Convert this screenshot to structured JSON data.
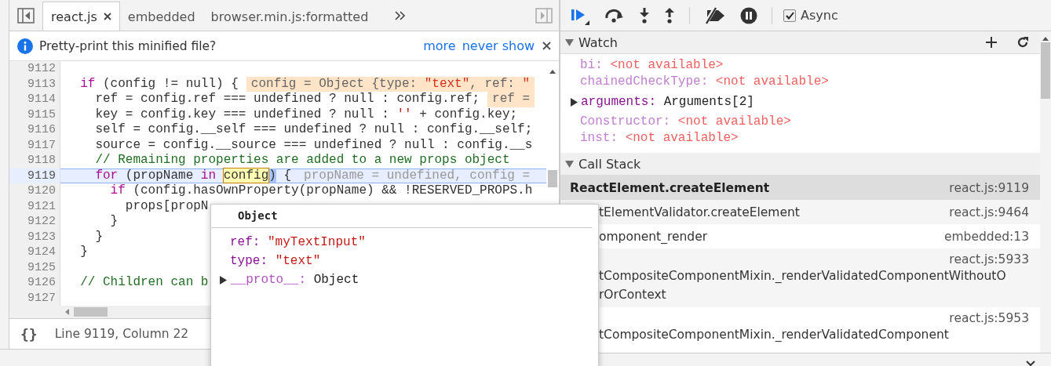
{
  "editor": {
    "tabs": [
      {
        "label": "react.js",
        "selected": true,
        "closable": true
      },
      {
        "label": "embedded",
        "selected": false,
        "closable": false
      },
      {
        "label": "browser.min.js:formatted",
        "selected": false,
        "closable": false
      }
    ],
    "infobar": {
      "message": "Pretty-print this minified file?",
      "links": [
        "more",
        "never show"
      ]
    },
    "lines": [
      {
        "number": "9112",
        "current": false
      },
      {
        "number": "9113",
        "current": false,
        "tokens": [
          {
            "kind": "kw",
            "t": "  if"
          },
          {
            "kind": "plain",
            "t": " (config != null) {"
          }
        ],
        "annotation": {
          "kind": "changed",
          "tokens": [
            {
              "kind": "plain",
              "t": "config = Object {type: "
            },
            {
              "kind": "str",
              "t": "\"text\""
            },
            {
              "kind": "plain",
              "t": ", ref: "
            },
            {
              "kind": "str",
              "t": "\""
            }
          ]
        }
      },
      {
        "number": "9114",
        "current": false,
        "tokens": [
          {
            "kind": "plain",
            "t": "    ref = config.ref === undefined ? null : config.ref;"
          }
        ],
        "annotation": {
          "kind": "changed",
          "tokens": [
            {
              "kind": "plain",
              "t": "ref ="
            }
          ]
        }
      },
      {
        "number": "9115",
        "current": false,
        "tokens": [
          {
            "kind": "plain",
            "t": "    key = config.key === undefined ? null : "
          },
          {
            "kind": "str",
            "t": "''"
          },
          {
            "kind": "plain",
            "t": " + config.key;"
          }
        ]
      },
      {
        "number": "9116",
        "current": false,
        "tokens": [
          {
            "kind": "plain",
            "t": "    self = config.__self === undefined ? null : config.__self;"
          }
        ]
      },
      {
        "number": "9117",
        "current": false,
        "tokens": [
          {
            "kind": "plain",
            "t": "    source = config.__source === undefined ? null : config.__s"
          }
        ]
      },
      {
        "number": "9118",
        "current": false,
        "tokens": [
          {
            "kind": "com",
            "t": "    // Remaining properties are added to a new props object"
          }
        ]
      },
      {
        "number": "9119",
        "current": true,
        "tokens": [
          {
            "kind": "kw",
            "t": "    for"
          },
          {
            "kind": "plain",
            "t": " (propName "
          },
          {
            "kind": "kw",
            "t": "in "
          },
          {
            "kind": "hl",
            "t": "config"
          },
          {
            "kind": "sel",
            "t": ")"
          },
          {
            "kind": "plain",
            "t": " {"
          }
        ],
        "annotation": {
          "kind": "unchanged",
          "tokens": [
            {
              "kind": "plain",
              "t": "propName = undefined, config ="
            }
          ]
        }
      },
      {
        "number": "9120",
        "current": false,
        "tokens": [
          {
            "kind": "kw",
            "t": "      if"
          },
          {
            "kind": "plain",
            "t": " (config.hasOwnProperty(propName) && !RESERVED_PROPS.h"
          }
        ]
      },
      {
        "number": "9121",
        "current": false,
        "tokens": [
          {
            "kind": "plain",
            "t": "        props[propN"
          }
        ]
      },
      {
        "number": "9122",
        "current": false,
        "tokens": [
          {
            "kind": "plain",
            "t": "      }"
          }
        ]
      },
      {
        "number": "9123",
        "current": false,
        "tokens": [
          {
            "kind": "plain",
            "t": "    }"
          }
        ]
      },
      {
        "number": "9124",
        "current": false,
        "tokens": [
          {
            "kind": "plain",
            "t": "  }"
          }
        ]
      },
      {
        "number": "9125",
        "current": false
      },
      {
        "number": "9126",
        "current": false,
        "tokens": [
          {
            "kind": "com",
            "t": "  // Children can b"
          }
        ]
      },
      {
        "number": "9127",
        "current": false
      }
    ],
    "format_button": "{}",
    "status": "Line 9119, Column 22"
  },
  "popover": {
    "title": "Object",
    "properties": [
      {
        "name": "ref:",
        "value": "\"myTextInput\"",
        "kind": "string"
      },
      {
        "name": "type:",
        "value": "\"text\"",
        "kind": "string"
      },
      {
        "name": "__proto__:",
        "value": "Object",
        "kind": "object",
        "expanded": false
      }
    ]
  },
  "debugger": {
    "async": {
      "label": "Async",
      "checked": true
    },
    "watch": {
      "title": "Watch",
      "expanded": true,
      "items": [
        {
          "name": "bi:",
          "value": "<not available>",
          "kind": "unavailable"
        },
        {
          "name": "chainedCheckType:",
          "value": "<not available>",
          "kind": "unavailable"
        },
        {
          "name": "arguments:",
          "value": "Arguments[2]",
          "kind": "object",
          "expanded": false
        },
        {
          "name": "Constructor:",
          "value": "<not available>",
          "kind": "unavailable"
        },
        {
          "name": "inst:",
          "value": "<not available>",
          "kind": "unavailable"
        }
      ]
    },
    "call_stack": {
      "title": "Call Stack",
      "expanded": true,
      "frames": [
        {
          "kind": "inline",
          "name_lines": [
            "ReactElement.createElement"
          ],
          "location": "react.js:9119",
          "selected": true
        },
        {
          "kind": "inline",
          "name_lines": [
            "tElementValidator.createElement"
          ],
          "location": "react.js:9464",
          "selected": false
        },
        {
          "kind": "inline",
          "name_lines": [
            "omponent_render"
          ],
          "location": "embedded:13",
          "selected": false
        },
        {
          "kind": "stacked",
          "name_lines": [
            "tCompositeComponentMixin._renderValidatedComponentWithoutO",
            "rOrContext"
          ],
          "location": "react.js:5933",
          "selected": false
        },
        {
          "kind": "stacked",
          "name_lines": [
            "tCompositeComponentMixin._renderValidatedComponent"
          ],
          "location": "react.js:5953",
          "selected": false
        }
      ]
    }
  }
}
